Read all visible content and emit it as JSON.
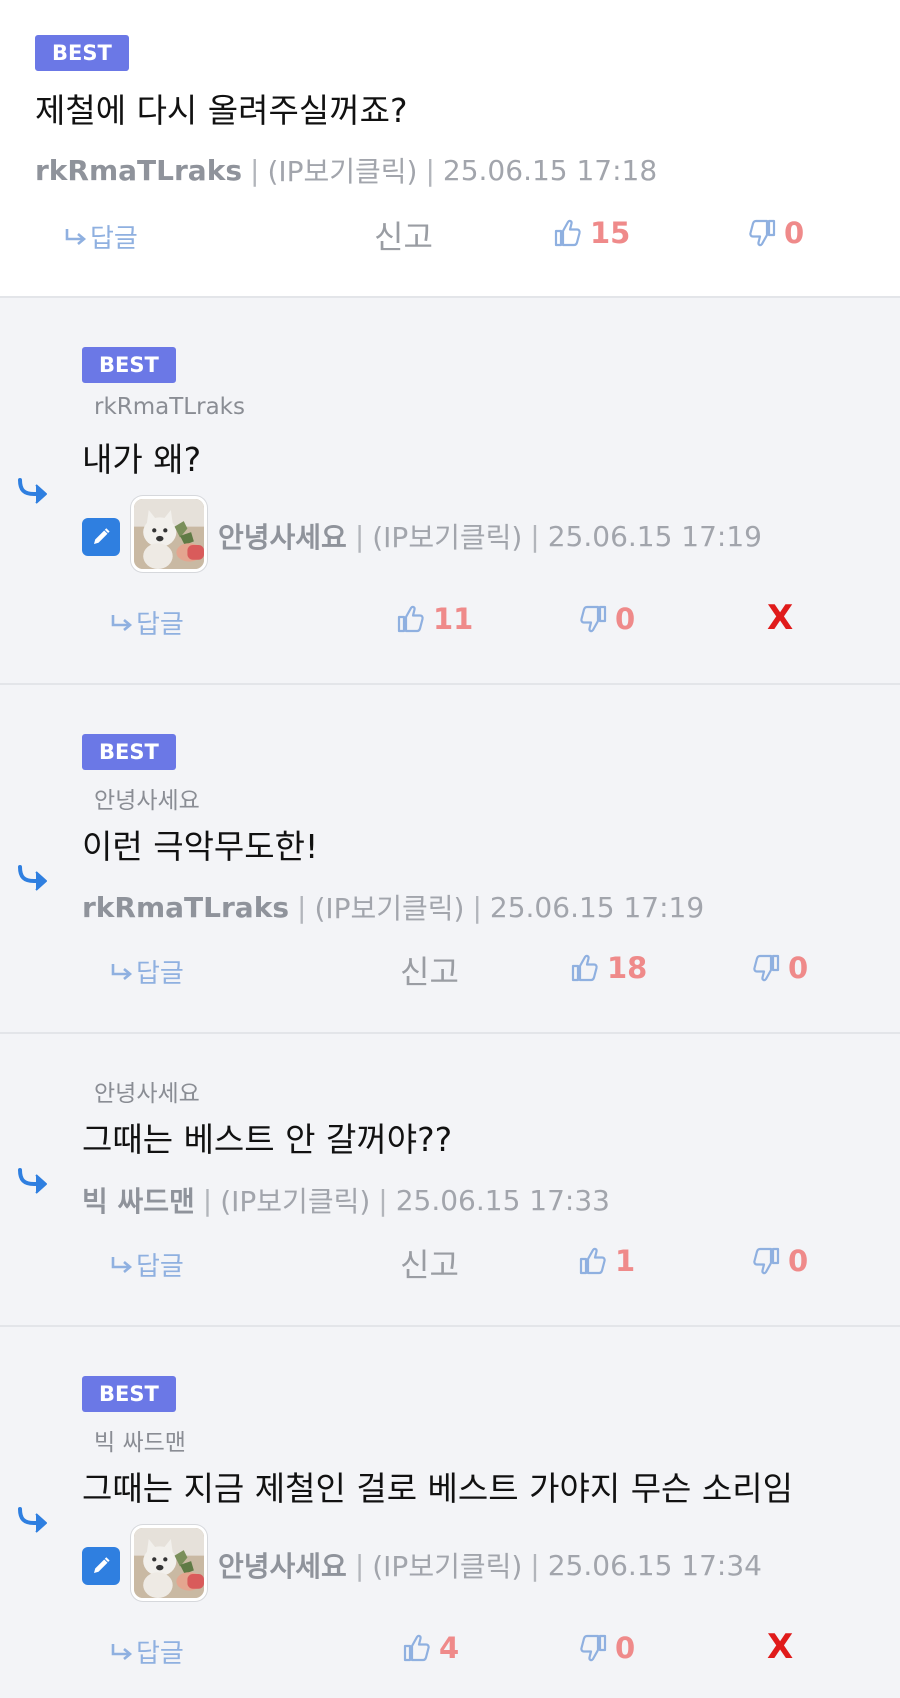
{
  "comments": [
    {
      "best": "BEST",
      "body": "제철에 다시 올려주실꺼죠?",
      "author": "rkRmaTLraks",
      "ip": "(IP보기클릭)",
      "time": "25.06.15 17:18",
      "reply": "답글",
      "report": "신고",
      "up": "15",
      "down": "0"
    },
    {
      "best": "BEST",
      "mention": "rkRmaTLraks",
      "body": "내가 왜?",
      "author": "안녕사세요",
      "ip": "(IP보기클릭)",
      "time": "25.06.15 17:19",
      "reply": "답글",
      "up": "11",
      "down": "0",
      "delete": "X"
    },
    {
      "best": "BEST",
      "mention": "안녕사세요",
      "body": "이런 극악무도한!",
      "author": "rkRmaTLraks",
      "ip": "(IP보기클릭)",
      "time": "25.06.15 17:19",
      "reply": "답글",
      "report": "신고",
      "up": "18",
      "down": "0"
    },
    {
      "mention": "안녕사세요",
      "body": "그때는 베스트 안 갈꺼야??",
      "author": "빅 싸드맨",
      "ip": "(IP보기클릭)",
      "time": "25.06.15 17:33",
      "reply": "답글",
      "report": "신고",
      "up": "1",
      "down": "0"
    },
    {
      "best": "BEST",
      "mention": "빅 싸드맨",
      "body": "그때는 지금 제철인 걸로 베스트 가야지 무슨 소리임",
      "author": "안녕사세요",
      "ip": "(IP보기클릭)",
      "time": "25.06.15 17:34",
      "reply": "답글",
      "up": "4",
      "down": "0",
      "delete": "X"
    }
  ],
  "colors": {
    "best_badge": "#6b78e6",
    "vote_count": "#ef8a8a",
    "vote_icon": "#8fb0e0",
    "delete": "#e01b1b",
    "edit_icon": "#2f7fe0",
    "reply_bg": "#f3f4f7"
  },
  "icons": [
    "reply-arrow-icon",
    "thumbs-up-icon",
    "thumbs-down-icon",
    "pencil-icon",
    "cat-avatar"
  ]
}
